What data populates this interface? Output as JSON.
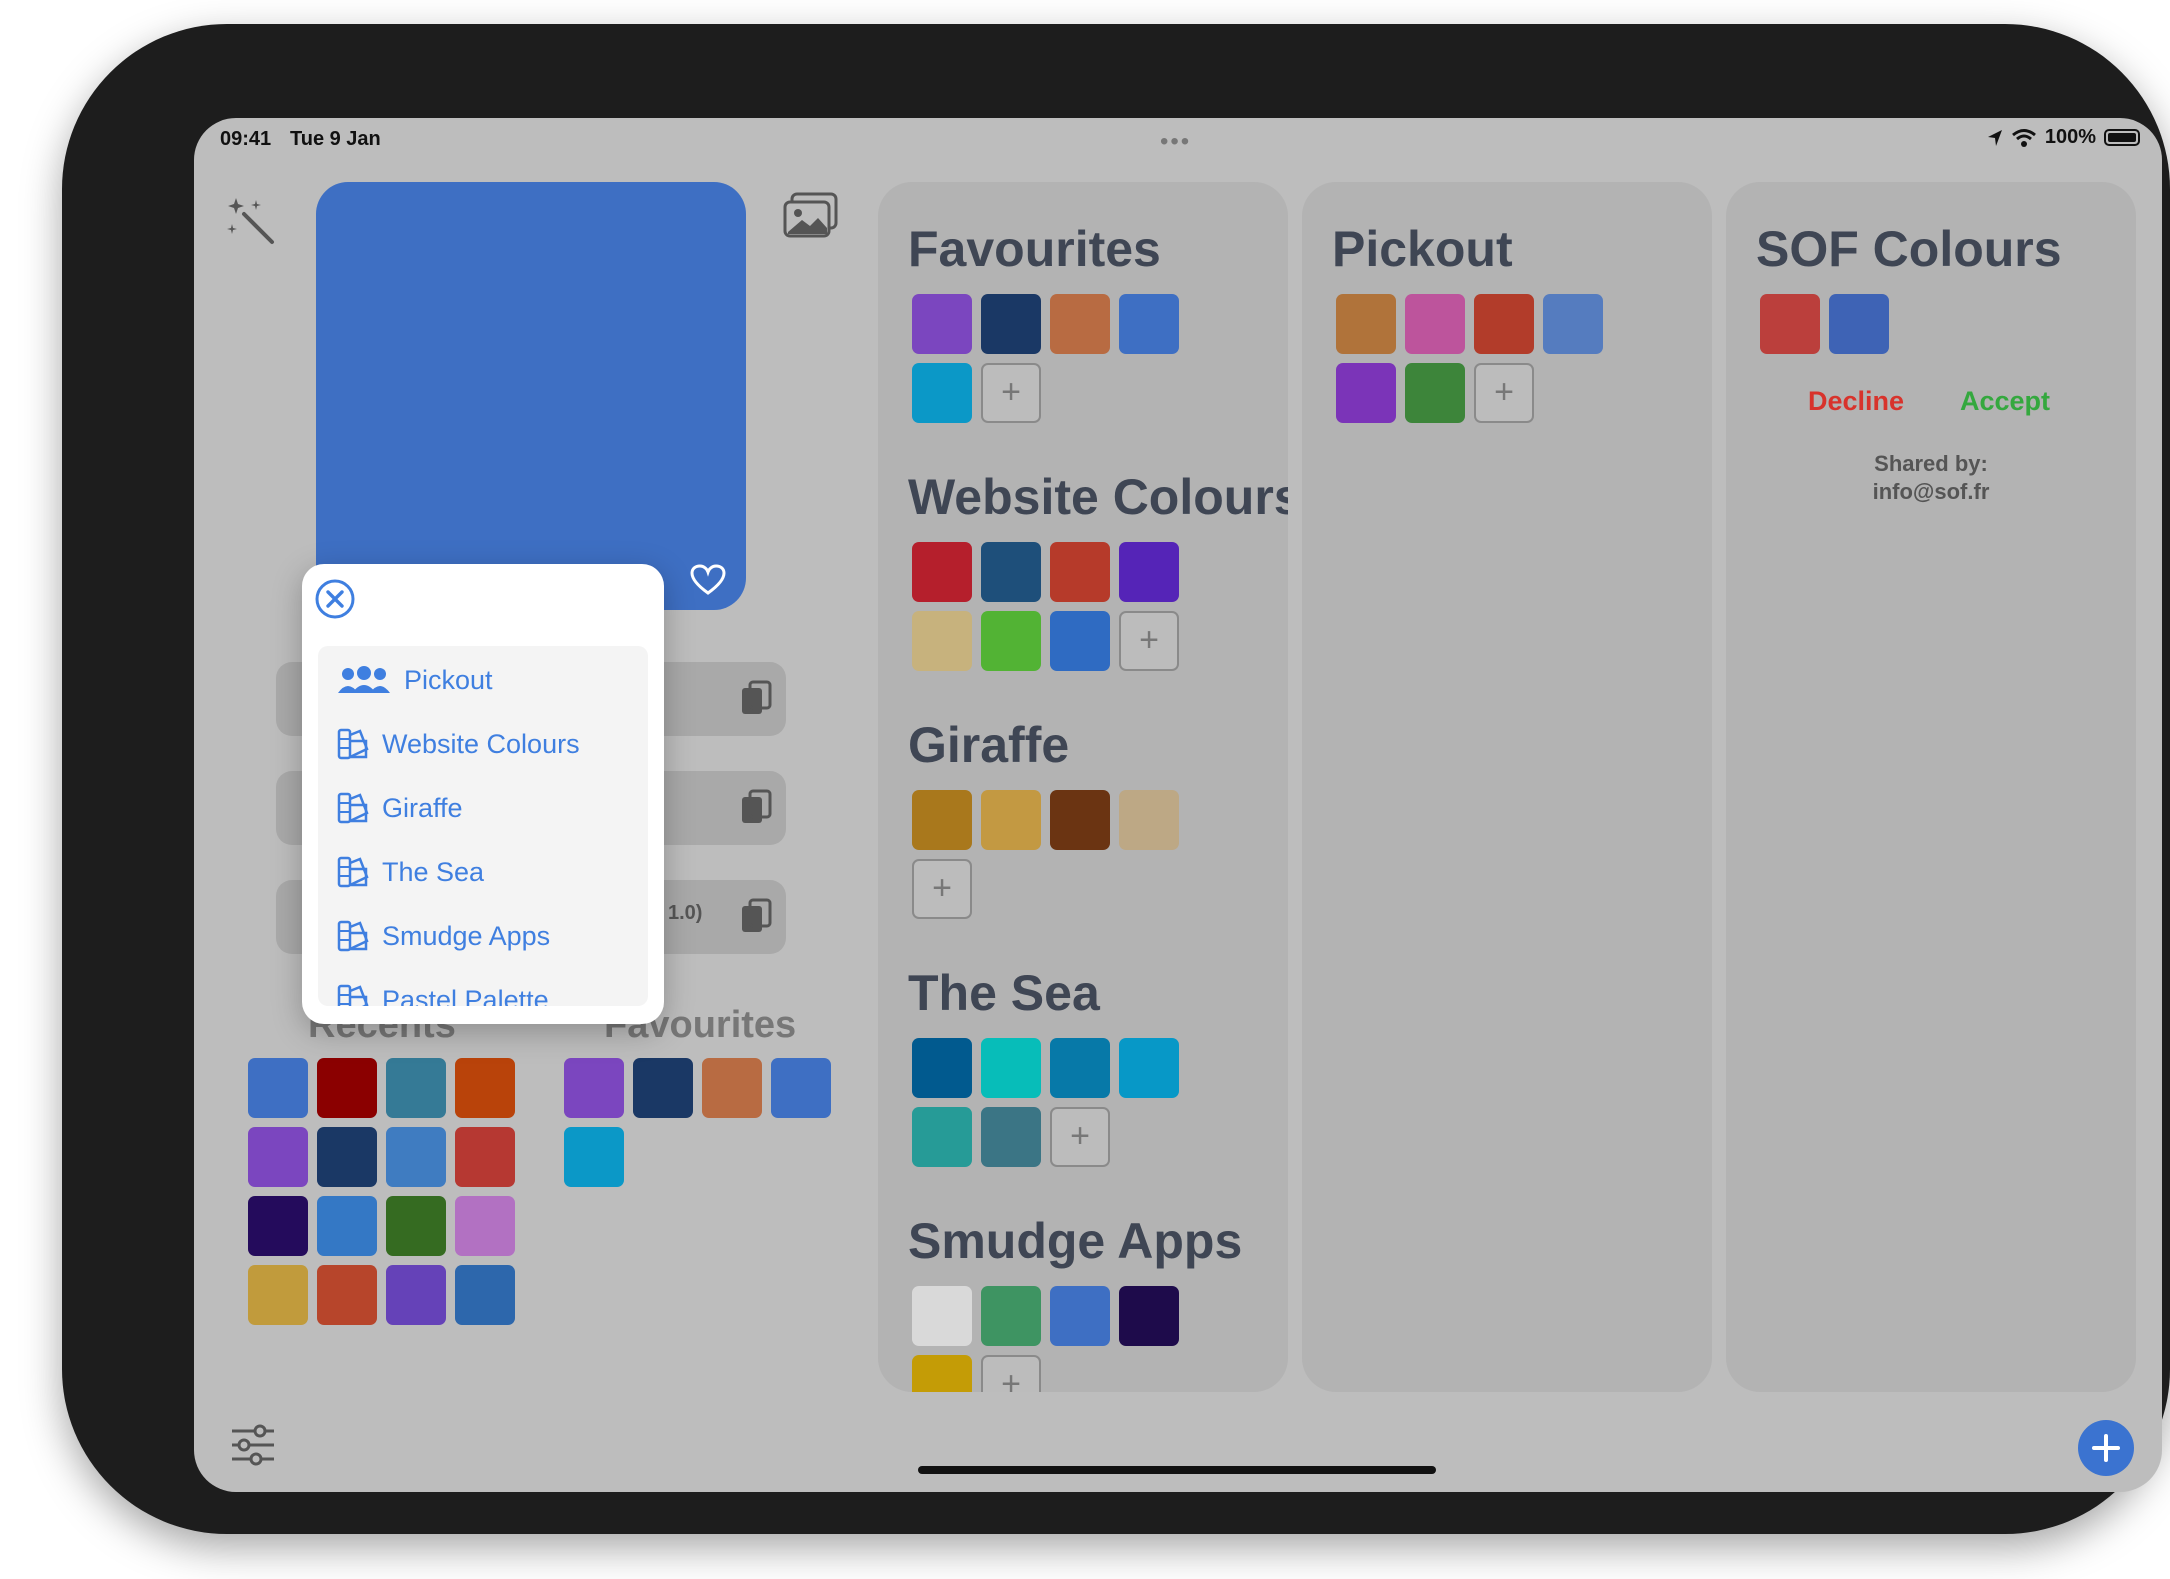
{
  "status_bar": {
    "time": "09:41",
    "date": "Tue 9 Jan",
    "battery": "100%"
  },
  "copy_fields": [
    {
      "value": ""
    },
    {
      "value": ""
    },
    {
      "value": "1.0)"
    }
  ],
  "recents": {
    "title": "Recents",
    "colors": [
      "#3e6fc3",
      "#8b0000",
      "#357a96",
      "#b9430a",
      "#7b46bf",
      "#1a3865",
      "#3f7cc1",
      "#b63832",
      "#240b5c",
      "#3478c5",
      "#356b21",
      "#b271c2",
      "#c19b3c",
      "#b7452b",
      "#6542b8",
      "#2d67ac"
    ]
  },
  "favourites_mini": {
    "title": "Favourites",
    "colors": [
      "#7b46bf",
      "#1a3865",
      "#b86b42",
      "#3e6fc3",
      "#0b98c7"
    ]
  },
  "collections": [
    {
      "title": "Favourites",
      "colors": [
        "#7b46bf",
        "#1a3865",
        "#b86b42",
        "#3e6fc3",
        "#0b98c7"
      ]
    },
    {
      "title": "Website Colours",
      "colors": [
        "#b51f2c",
        "#1e4f7a",
        "#b63a2a",
        "#5524b7",
        "#c7b27d",
        "#52b334",
        "#2f6bc2"
      ]
    },
    {
      "title": "Giraffe",
      "colors": [
        "#a9781c",
        "#c39942",
        "#6b3412",
        "#bda885"
      ]
    },
    {
      "title": "The Sea",
      "colors": [
        "#015a8f",
        "#07bdb9",
        "#0779a8",
        "#0798c7",
        "#269b97",
        "#3b7585"
      ]
    },
    {
      "title": "Smudge Apps",
      "colors": [
        "#d9d9d9",
        "#3e9462",
        "#3e6fc3",
        "#1e0b4b",
        "#c49c06"
      ]
    }
  ],
  "pickout": {
    "title": "Pickout",
    "colors": [
      "#b0733a",
      "#bd549c",
      "#b23c2a",
      "#557cbf",
      "#7b34b8",
      "#3d853a"
    ]
  },
  "sof": {
    "title": "SOF Colours",
    "colors": [
      "#bb3f3c",
      "#3e63b5"
    ],
    "decline_label": "Decline",
    "accept_label": "Accept",
    "shared_by_label": "Shared by:",
    "shared_by_email": "info@sof.fr"
  },
  "menu": {
    "items": [
      {
        "label": "Pickout",
        "icon": "people-icon"
      },
      {
        "label": "Website Colours",
        "icon": "palette-swatch-icon"
      },
      {
        "label": "Giraffe",
        "icon": "palette-swatch-icon"
      },
      {
        "label": "The Sea",
        "icon": "palette-swatch-icon"
      },
      {
        "label": "Smudge Apps",
        "icon": "palette-swatch-icon"
      },
      {
        "label": "Pastel Palette",
        "icon": "palette-swatch-icon"
      }
    ]
  },
  "accent_color": "#3f7fe0"
}
